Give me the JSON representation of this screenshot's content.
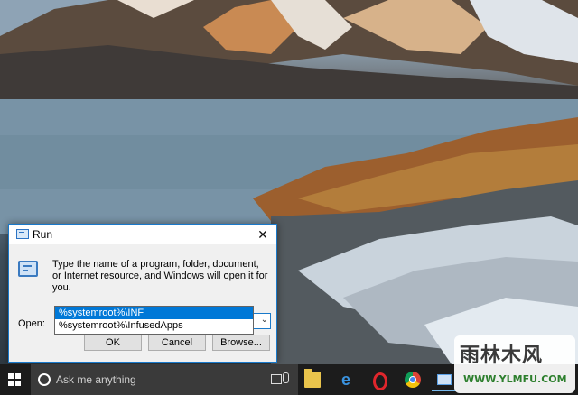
{
  "run_dialog": {
    "title": "Run",
    "close_glyph": "✕",
    "description": "Type the name of a program, folder, document, or Internet resource, and Windows will open it for you.",
    "open_label": "Open:",
    "open_value": "%systemroot%\\INF",
    "buttons": {
      "ok": "OK",
      "cancel": "Cancel",
      "browse": "Browse..."
    },
    "autocomplete": [
      "%systemroot%\\INF",
      "%systemroot%\\InfusedApps"
    ]
  },
  "taskbar": {
    "search_placeholder": "Ask me anything",
    "apps": [
      "file-explorer-icon",
      "edge-icon",
      "opera-icon",
      "chrome-icon",
      "run-icon"
    ]
  },
  "watermark": {
    "top": "雨林木风",
    "bottom": "WWW.YLMFU.COM"
  },
  "colors": {
    "accent": "#0078d7",
    "taskbar": "#1c1c1c",
    "search_bg": "#3a3a3a"
  }
}
